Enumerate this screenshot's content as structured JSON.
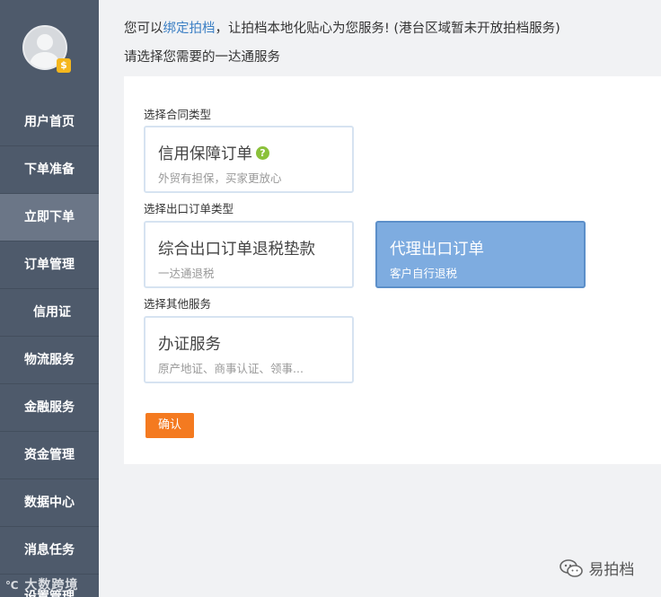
{
  "sidebar": {
    "items": [
      {
        "label": "用户首页",
        "active": false
      },
      {
        "label": "下单准备",
        "active": false
      },
      {
        "label": "立即下单",
        "active": true
      },
      {
        "label": "订单管理",
        "active": false
      },
      {
        "label": "信用证",
        "active": false
      },
      {
        "label": "物流服务",
        "active": false
      },
      {
        "label": "金融服务",
        "active": false
      },
      {
        "label": "资金管理",
        "active": false
      },
      {
        "label": "数据中心",
        "active": false
      },
      {
        "label": "消息任务",
        "active": false
      }
    ],
    "clipped_item": "设置管理",
    "avatar_badge": "$",
    "watermark": "大数跨境"
  },
  "notice": {
    "prefix": "您可以",
    "link": "绑定拍档",
    "suffix": "，让拍档本地化贴心为您服务! (港台区域暂未开放拍档服务)",
    "subtitle": "请选择您需要的一达通服务"
  },
  "sections": {
    "contract_label": "选择合同类型",
    "export_label": "选择出口订单类型",
    "other_label": "选择其他服务"
  },
  "cards": {
    "credit": {
      "title": "信用保障订单",
      "desc": "外贸有担保，买家更放心",
      "help": "?"
    },
    "comprehensive": {
      "title": "综合出口订单退税垫款",
      "desc": "一达通退税"
    },
    "agency": {
      "title": "代理出口订单",
      "desc": "客户自行退税",
      "selected": true
    },
    "certificate": {
      "title": "办证服务",
      "desc": "原产地证、商事认证、领事..."
    }
  },
  "confirm_label": "确认",
  "brand": {
    "name": "易拍档"
  },
  "colors": {
    "sidebar_bg": "#4e5a6b",
    "sidebar_active": "#6b7687",
    "selected_card": "#7eace0",
    "confirm": "#f47a20",
    "link": "#3b7fc4",
    "help_icon": "#8bc13b"
  }
}
